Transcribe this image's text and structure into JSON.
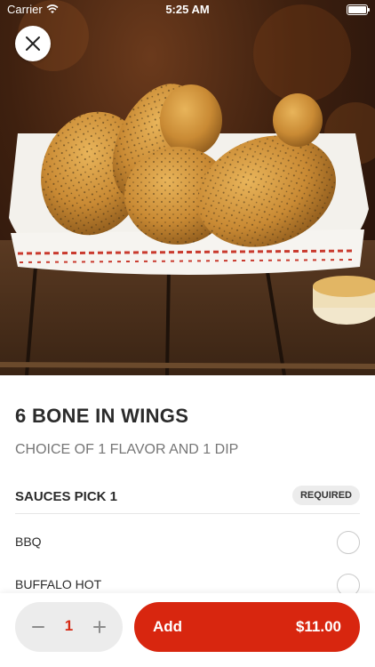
{
  "status_bar": {
    "carrier": "Carrier",
    "time": "5:25 AM"
  },
  "hero": {
    "image_name": "6 bone in wings in paper tray with dipping sauce on wooden table"
  },
  "product": {
    "title": "6 BONE IN WINGS",
    "subtitle": "CHOICE OF 1 FLAVOR AND 1 DIP"
  },
  "sauces": {
    "title": "SAUCES PICK 1",
    "badge": "REQUIRED",
    "options": [
      {
        "label": "BBQ"
      },
      {
        "label": "BUFFALO HOT"
      }
    ]
  },
  "cart": {
    "quantity": "1",
    "add_label": "Add",
    "price": "$11.00"
  },
  "colors": {
    "accent": "#d8260f",
    "quantity_text": "#d62a14",
    "text_primary": "#2b2b2b",
    "text_secondary": "#767676"
  }
}
